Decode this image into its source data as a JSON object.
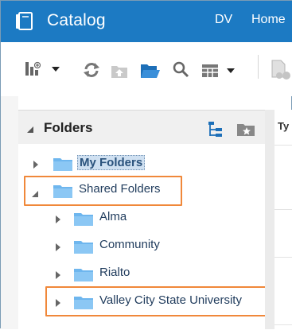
{
  "header": {
    "title": "Catalog",
    "nav": [
      "DV",
      "Home"
    ],
    "background_color": "#1c7ac3",
    "app_icon": "catalog-book-icon"
  },
  "toolbar": {
    "icons": [
      "new-item-icon",
      "refresh-icon",
      "upload-icon",
      "open-folder-icon",
      "search-icon",
      "view-menu-icon",
      "properties-icon"
    ]
  },
  "folders_panel": {
    "title": "Folders",
    "icons": [
      "tree-view-icon",
      "add-favorite-icon"
    ],
    "items": [
      {
        "label": "My Folders",
        "level": 0,
        "expanded": false,
        "selected": true
      },
      {
        "label": "Shared Folders",
        "level": 0,
        "expanded": true,
        "selected": false
      },
      {
        "label": "Alma",
        "level": 1,
        "expanded": false,
        "selected": false
      },
      {
        "label": "Community",
        "level": 1,
        "expanded": false,
        "selected": false
      },
      {
        "label": "Rialto",
        "level": 1,
        "expanded": false,
        "selected": false
      },
      {
        "label": "Valley City State University",
        "level": 1,
        "expanded": false,
        "selected": false
      }
    ]
  },
  "right_panel": {
    "column_label": "Ty"
  },
  "highlight_color": "#f0883a"
}
